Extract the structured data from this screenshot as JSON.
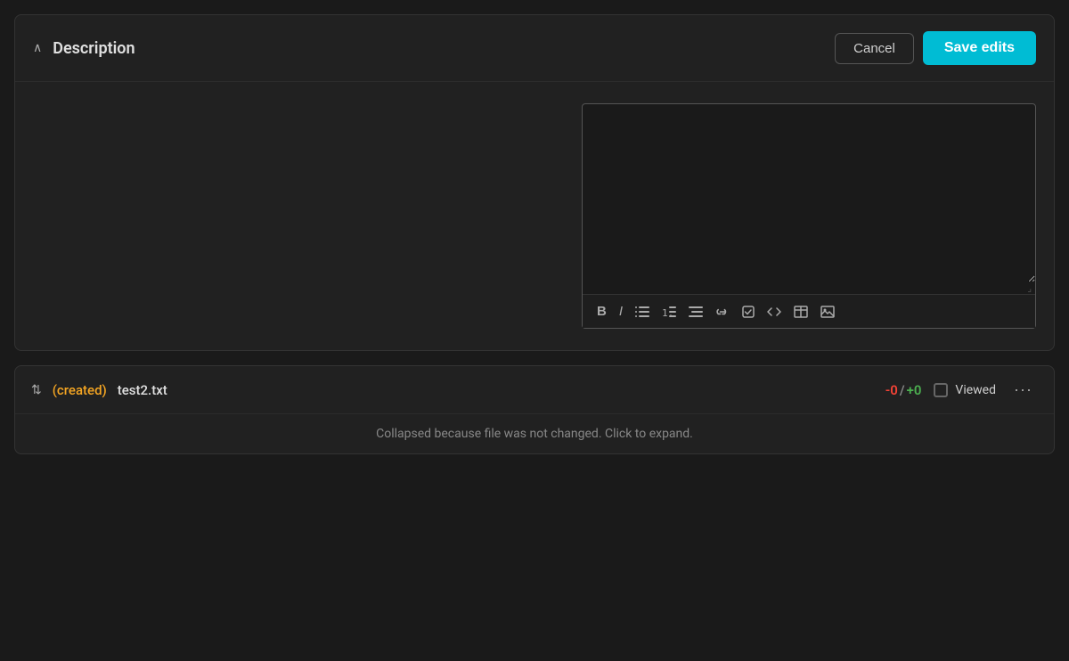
{
  "header": {
    "title": "Description",
    "cancel_label": "Cancel",
    "save_edits_label": "Save edits"
  },
  "editor": {
    "placeholder": "",
    "toolbar": {
      "bold_label": "B",
      "italic_label": "I",
      "bullet_list_symbol": "☰",
      "numbered_list_symbol": "≡",
      "indent_symbol": "≡",
      "link_symbol": "🔗",
      "checkbox_symbol": "☑",
      "code_symbol": "<>",
      "table_symbol": "⊞",
      "image_symbol": "🖼"
    }
  },
  "file": {
    "created_label": "(created)",
    "name": "test2.txt",
    "diff_minus": "-0",
    "diff_slash": "/",
    "diff_plus": "+0",
    "viewed_label": "Viewed",
    "collapsed_message": "Collapsed because file was not changed. Click to expand."
  },
  "icons": {
    "chevron_up": "∧",
    "expand": "⇅",
    "more": "···"
  }
}
